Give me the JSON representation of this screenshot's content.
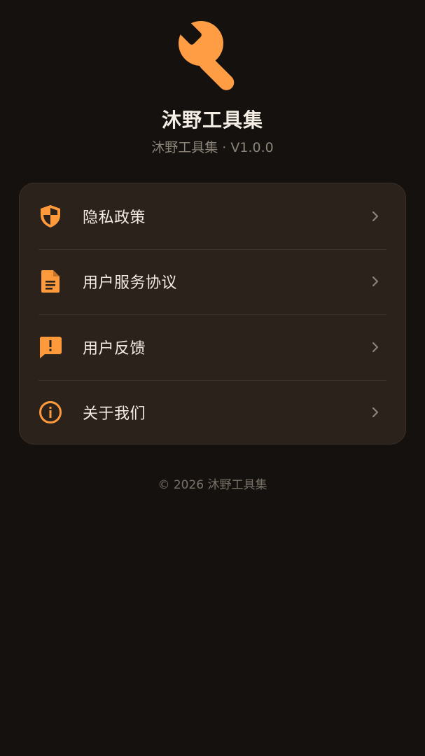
{
  "app": {
    "title": "沐野工具集",
    "subtitle": "沐野工具集 · V1.0.0",
    "logo_icon": "wrench-icon",
    "accent_color": "#ff9a3c"
  },
  "menu": {
    "items": [
      {
        "label": "隐私政策",
        "icon": "shield-icon"
      },
      {
        "label": "用户服务协议",
        "icon": "document-icon"
      },
      {
        "label": "用户反馈",
        "icon": "feedback-icon"
      },
      {
        "label": "关于我们",
        "icon": "info-icon"
      }
    ],
    "chevron_icon": "chevron-right-icon"
  },
  "footer": {
    "copyright": "© 2026 沐野工具集"
  }
}
